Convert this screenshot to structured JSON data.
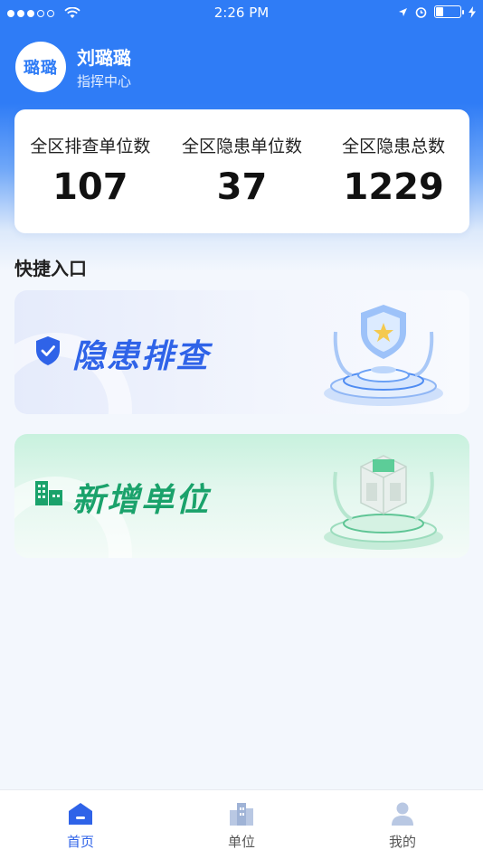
{
  "status_bar": {
    "time": "2:26 PM",
    "signal_dots_filled": 3,
    "signal_dots_total": 5,
    "battery_level": 0.3
  },
  "profile": {
    "avatar_text": "璐璐",
    "name": "刘璐璐",
    "role": "指挥中心"
  },
  "stats": [
    {
      "label": "全区排查单位数",
      "value": "107"
    },
    {
      "label": "全区隐患单位数",
      "value": "37"
    },
    {
      "label": "全区隐患总数",
      "value": "1229"
    }
  ],
  "quick_entry": {
    "title": "快捷入口",
    "items": [
      {
        "label": "隐患排查",
        "icon": "shield-check-icon",
        "color": "#2f63e8"
      },
      {
        "label": "新增单位",
        "icon": "building-icon",
        "color": "#1aa26b"
      }
    ]
  },
  "tab_bar": {
    "tabs": [
      {
        "label": "首页",
        "icon": "home-icon",
        "active": true
      },
      {
        "label": "单位",
        "icon": "buildings-icon",
        "active": false
      },
      {
        "label": "我的",
        "icon": "person-icon",
        "active": false
      }
    ]
  },
  "colors": {
    "primary": "#2f7cf6",
    "accent_blue": "#2f63e8",
    "accent_green": "#1aa26b"
  }
}
